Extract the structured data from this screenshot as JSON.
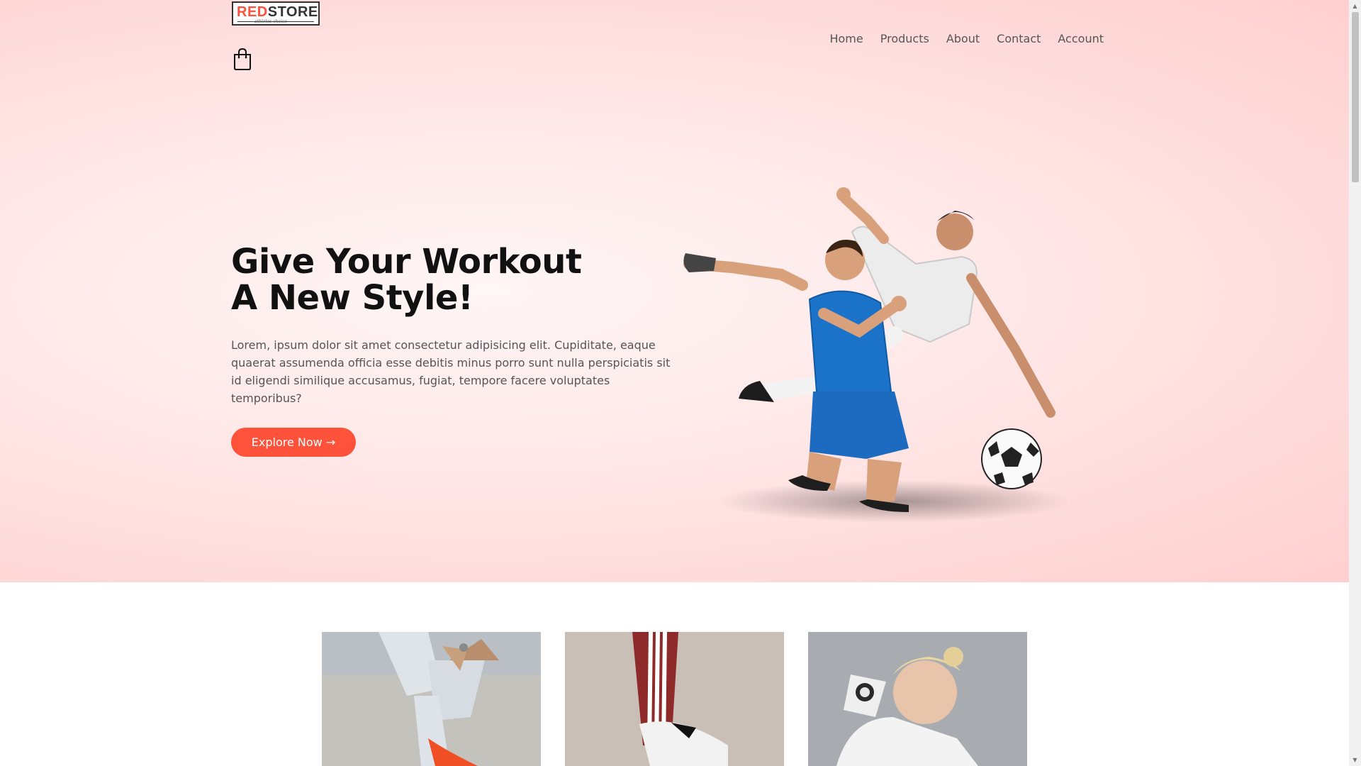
{
  "brand": {
    "logo_part1": "RED",
    "logo_part2": "STORE",
    "tagline": "athletes choice",
    "accent_color": "#ff523b"
  },
  "nav": {
    "items": [
      {
        "label": "Home"
      },
      {
        "label": "Products"
      },
      {
        "label": "About"
      },
      {
        "label": "Contact"
      },
      {
        "label": "Account"
      }
    ],
    "cart_icon": "shopping-bag-icon"
  },
  "hero": {
    "title_line1": "Give Your Workout",
    "title_line2": "A New Style!",
    "description": "Lorem, ipsum dolor sit amet consectetur adipisicing elit. Cupiditate, eaque quaerat assumenda officia esse debitis minus porro sunt nulla perspiciatis sit id eligendi similique accusamus, fugiat, tempore facere voluptates temporibus?",
    "button_label": "Explore Now →",
    "image": "football-players-image"
  },
  "categories": [
    {
      "image": "ripped-jeans-red-sneakers-image"
    },
    {
      "image": "striped-track-pants-white-sneaker-image"
    },
    {
      "image": "woman-smartwatch-hoodie-image"
    }
  ]
}
